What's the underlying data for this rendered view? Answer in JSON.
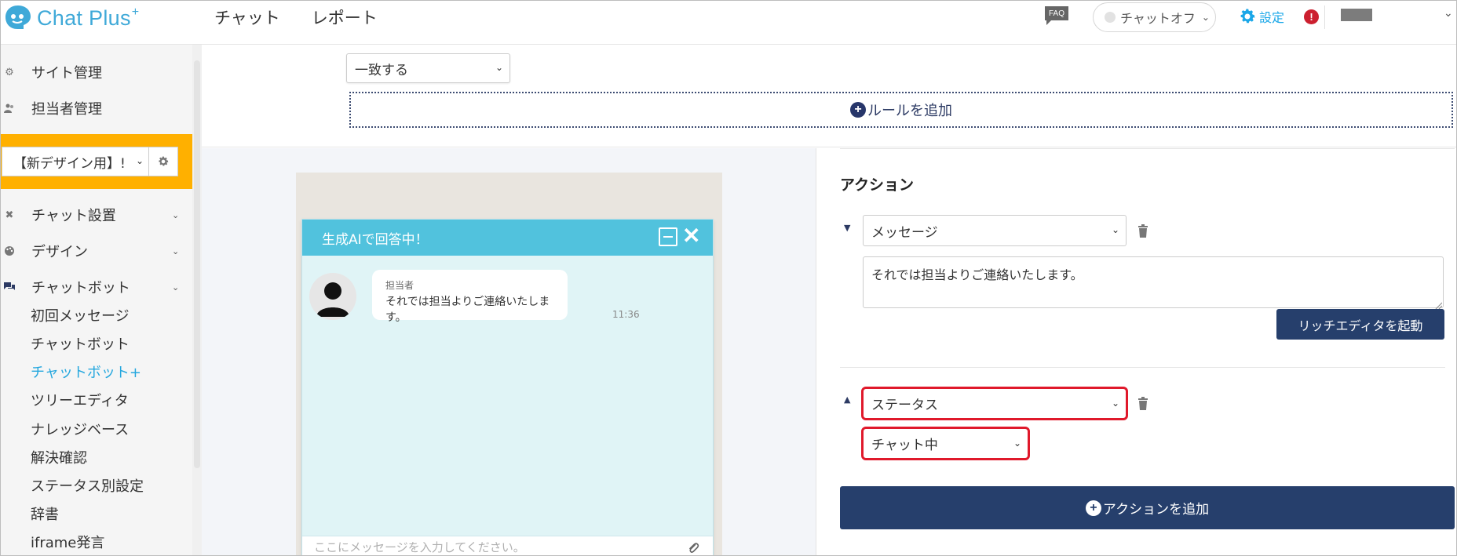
{
  "app": {
    "logo_text": "Chat Plus",
    "logo_sup": "+",
    "nav": [
      "チャット",
      "レポート"
    ],
    "faq_label": "FAQ",
    "chat_status": "チャットオフ",
    "settings_label": "設定",
    "alert_mark": "!"
  },
  "sidebar": {
    "site_admin": "サイト管理",
    "staff_admin": "担当者管理",
    "site_select_value": "【新デザイン用】!",
    "chat_setup": "チャット設置",
    "design": "デザイン",
    "chatbot": "チャットボット",
    "chatbot_items": [
      "初回メッセージ",
      "チャットボット",
      "チャットボット+",
      "ツリーエディタ",
      "ナレッジベース",
      "解決確認",
      "ステータス別設定",
      "辞書",
      "iframe発言"
    ],
    "active_index": 2
  },
  "rules": {
    "match_select": "一致する",
    "add_rule_label": "ルールを追加"
  },
  "preview": {
    "header_title": "生成AIで回答中！",
    "sender": "担当者",
    "message": "それでは担当よりご連絡いたします。",
    "time": "11:36",
    "input_placeholder": "ここにメッセージを入力してください。"
  },
  "actions": {
    "title": "アクション",
    "action1_type": "メッセージ",
    "action1_text": "それでは担当よりご連絡いたします。",
    "rich_editor_label": "リッチエディタを起動",
    "action2_type": "ステータス",
    "action2_value": "チャット中",
    "add_action_label": "アクションを追加"
  },
  "colors": {
    "accent": "#25a7de",
    "navy": "#263f6c",
    "highlight_orange": "#ffb000",
    "highlight_red": "#e0192b",
    "widget_header": "#51c2dd"
  }
}
